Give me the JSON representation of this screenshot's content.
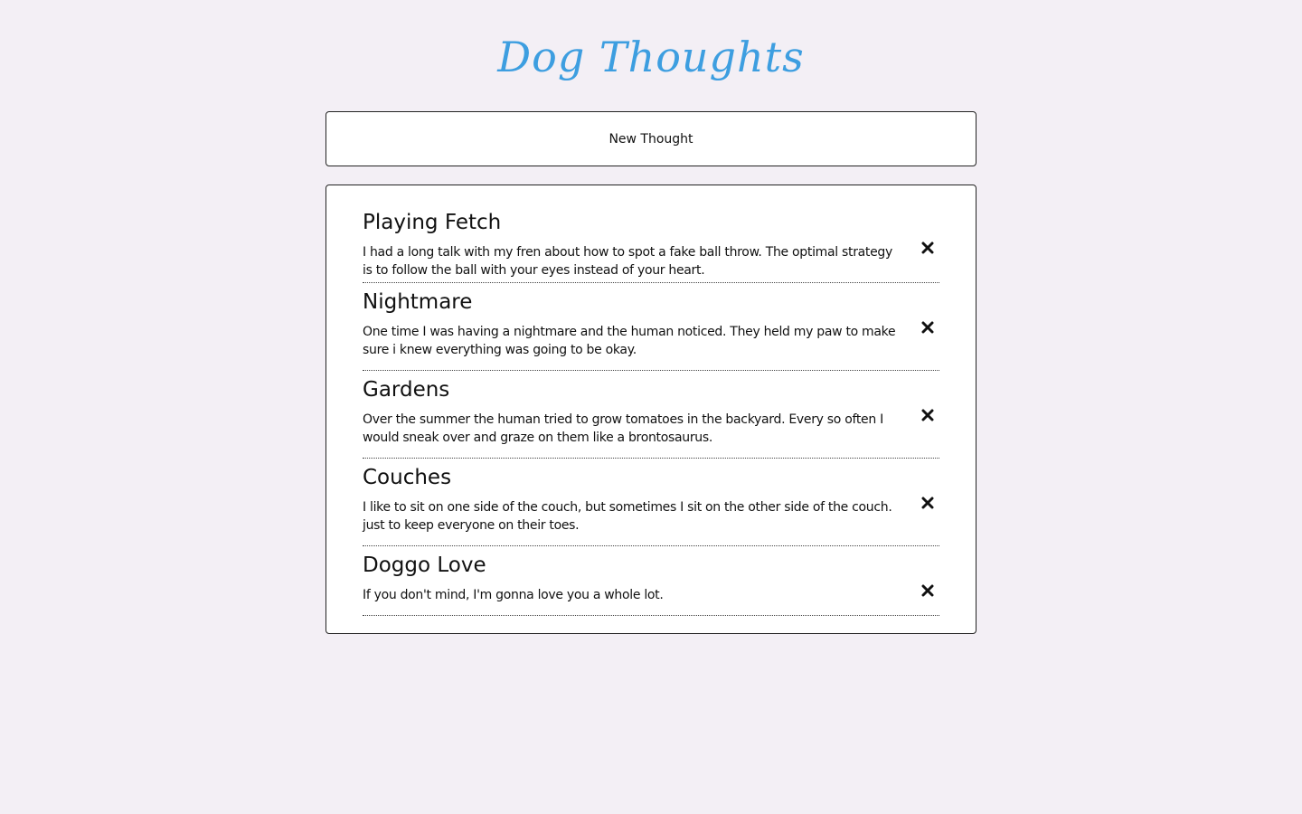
{
  "app": {
    "title": "Dog Thoughts",
    "accent_color": "#3d9ee0"
  },
  "toolbar": {
    "new_thought_label": "New Thought"
  },
  "thoughts": [
    {
      "title": "Playing Fetch",
      "body": "I had a long talk with my fren about how to spot a fake ball throw. The optimal strategy is to follow the ball with your eyes instead of your heart.",
      "delete_icon": "close-icon"
    },
    {
      "title": "Nightmare",
      "body": "One time I was having a nightmare and the human noticed. They held my paw to make sure i knew everything was going to be okay.",
      "delete_icon": "close-icon"
    },
    {
      "title": "Gardens",
      "body": "Over the summer the human tried to grow tomatoes in the backyard. Every so often I would sneak over and graze on them like a brontosaurus.",
      "delete_icon": "close-icon"
    },
    {
      "title": "Couches",
      "body": "I like to sit on one side of the couch, but sometimes I sit on the other side of the couch. just to keep everyone on their toes.",
      "delete_icon": "close-icon"
    },
    {
      "title": "Doggo Love",
      "body": "If you don't mind, I'm gonna love you a whole lot.",
      "delete_icon": "close-icon"
    }
  ]
}
